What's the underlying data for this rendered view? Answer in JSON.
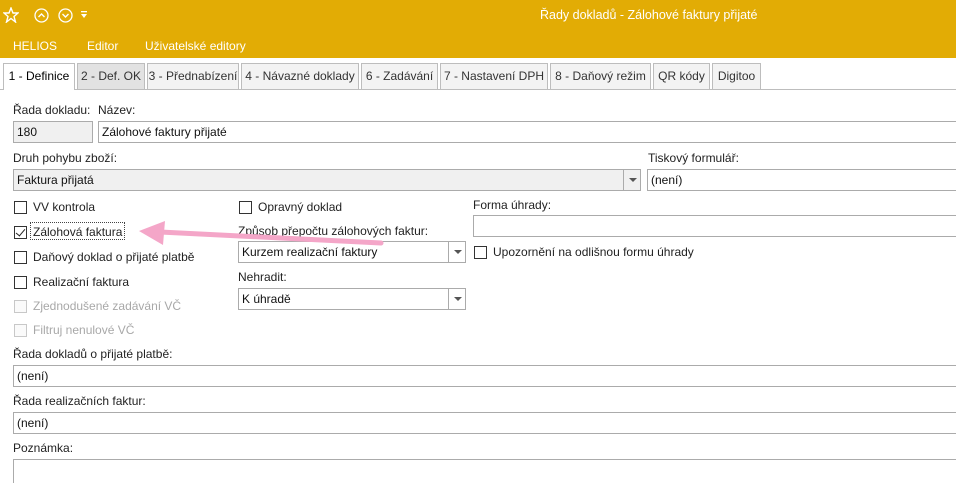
{
  "titlebar": {
    "title": "Řady dokladů - Zálohové faktury přijaté",
    "icons": [
      "app-logo-icon",
      "collapse-circle-icon",
      "expand-circle-icon",
      "quick-access-dropdown-icon"
    ]
  },
  "menubar": {
    "items": [
      "HELIOS",
      "Editor",
      "Uživatelské editory"
    ]
  },
  "tabs": [
    {
      "label": "1 - Definice",
      "state": "active"
    },
    {
      "label": "2 - Def. OK",
      "state": "hover"
    },
    {
      "label": "3 - Přednabízení",
      "state": "normal"
    },
    {
      "label": "4 - Návazné doklady",
      "state": "normal"
    },
    {
      "label": "6 - Zadávání",
      "state": "normal"
    },
    {
      "label": "7 - Nastavení DPH",
      "state": "normal"
    },
    {
      "label": "8 - Daňový režim",
      "state": "normal"
    },
    {
      "label": "QR kódy",
      "state": "normal"
    },
    {
      "label": "Digitoo",
      "state": "normal"
    }
  ],
  "form": {
    "rada_label": "Řada dokladu:",
    "rada_value": "180",
    "nazev_label": "Název:",
    "nazev_value": "Zálohové faktury přijaté",
    "druh_label": "Druh pohybu zboží:",
    "druh_value": "Faktura přijatá",
    "tiskovy_label": "Tiskový formulář:",
    "tiskovy_value": "(není)",
    "forma_label": "Forma úhrady:",
    "forma_value": "",
    "checkboxes": [
      {
        "label": "VV kontrola",
        "checked": false,
        "enabled": true
      },
      {
        "label": "Zálohová faktura",
        "checked": true,
        "enabled": true
      },
      {
        "label": "Daňový doklad o přijaté platbě",
        "checked": false,
        "enabled": true
      },
      {
        "label": "Realizační faktura",
        "checked": false,
        "enabled": true
      },
      {
        "label": "Zjednodušené zadávání VČ",
        "checked": false,
        "enabled": false
      },
      {
        "label": "Filtruj nenulové VČ",
        "checked": false,
        "enabled": false
      }
    ],
    "opravny_label": "Opravný doklad",
    "opravny_checked": false,
    "zpusob_label": "Způsob přepočtu zálohových faktur:",
    "zpusob_value": "Kurzem realizační faktury",
    "nehradit_label": "Nehradit:",
    "nehradit_value": "K úhradě",
    "upozorneni_label": "Upozornění na odlišnou formu úhrady",
    "upozorneni_checked": false,
    "rada_platbe_label": "Řada dokladů o přijaté platbě:",
    "rada_platbe_value": "(není)",
    "rada_realizacnich_label": "Řada realizačních faktur:",
    "rada_realizacnich_value": "(není)",
    "poznamka_label": "Poznámka:",
    "poznamka_value": ""
  },
  "annotation": {
    "arrow_color": "#f4a6c8"
  },
  "colors": {
    "accent": "#e2ac05"
  }
}
